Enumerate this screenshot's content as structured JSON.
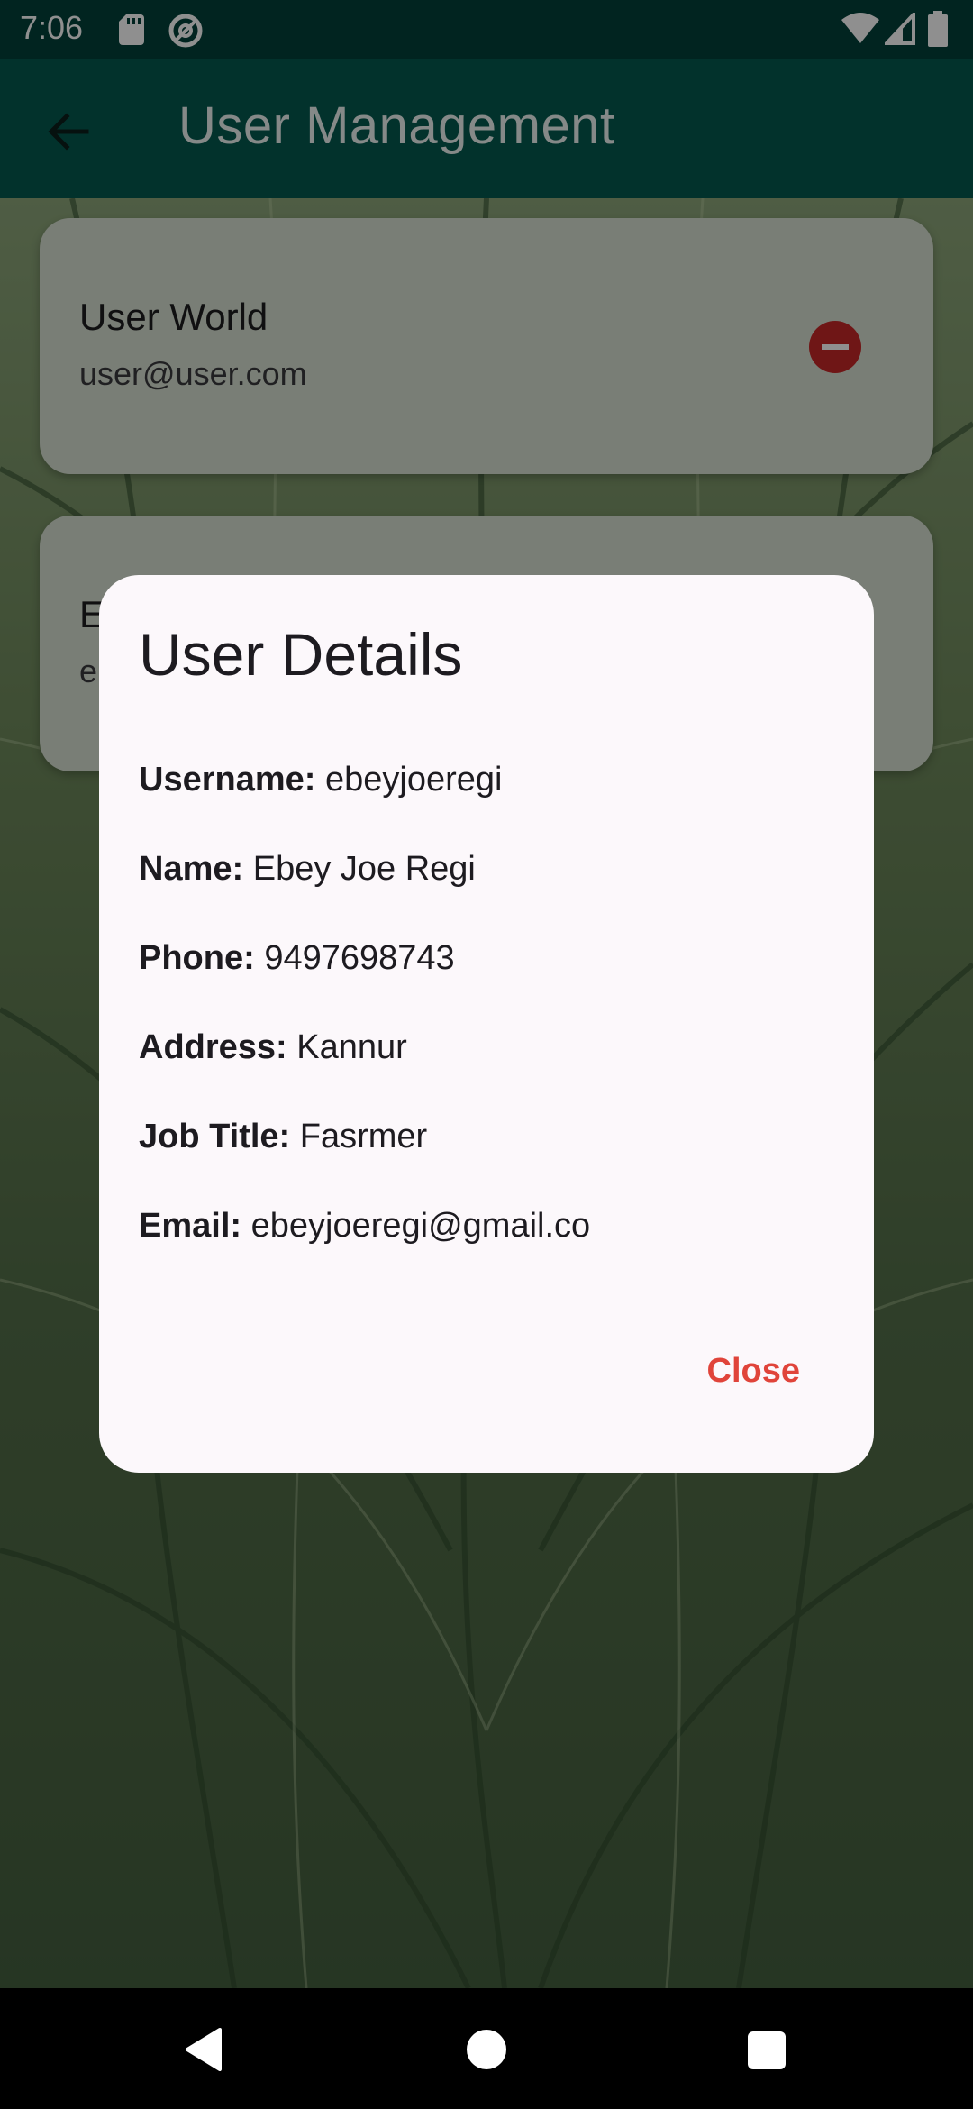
{
  "status_bar": {
    "time": "7:06",
    "icons": [
      "sd-card-icon",
      "at-icon",
      "wifi-icon",
      "signal-icon",
      "battery-icon"
    ]
  },
  "app_bar": {
    "title": "User Management",
    "back_icon": "arrow-left-icon"
  },
  "users": [
    {
      "name": "User World",
      "email": "user@user.com"
    },
    {
      "name": "E",
      "email": "e"
    }
  ],
  "dialog": {
    "title": "User Details",
    "fields": [
      {
        "label": "Username:",
        "value": "ebeyjoeregi"
      },
      {
        "label": "Name:",
        "value": "Ebey Joe Regi"
      },
      {
        "label": "Phone:",
        "value": "9497698743"
      },
      {
        "label": "Address:",
        "value": "Kannur"
      },
      {
        "label": "Job Title:",
        "value": "Fasrmer"
      },
      {
        "label": "Email:",
        "value": "ebeyjoeregi@gmail.co"
      }
    ],
    "close_label": "Close"
  },
  "colors": {
    "app_bar": "#04594f",
    "status_bar": "#034039",
    "accent_close": "#e0443a",
    "remove_button": "#c62828",
    "dialog_bg": "#fcf8fb"
  },
  "nav_bar": {
    "icons": [
      "nav-back-icon",
      "nav-home-icon",
      "nav-recents-icon"
    ]
  }
}
